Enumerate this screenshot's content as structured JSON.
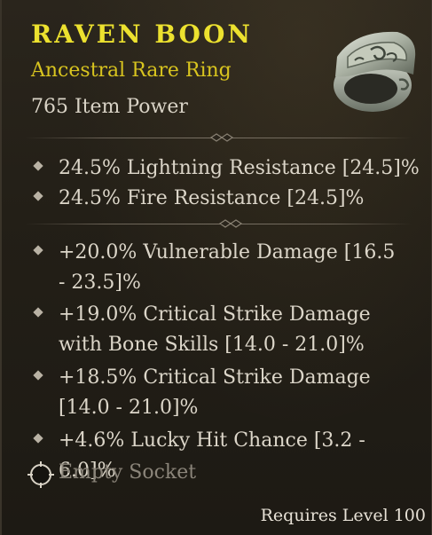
{
  "item": {
    "name": "RAVEN BOON",
    "rarity_type": "Ancestral Rare Ring",
    "item_power": "765 Item Power",
    "image": "ring-icon"
  },
  "implicits": [
    "24.5% Lightning Resistance [24.5]%",
    "24.5% Fire Resistance [24.5]%"
  ],
  "affixes": [
    "+20.0% Vulnerable Damage [16.5 - 23.5]%",
    "+19.0% Critical Strike Damage with Bone Skills [14.0 - 21.0]%",
    "+18.5% Critical Strike Damage [14.0 - 21.0]%",
    "+4.6% Lucky Hit Chance [3.2 - 6.0]%"
  ],
  "socket": {
    "label": "Empty Socket",
    "icon": "socket-icon"
  },
  "requirement": "Requires Level 100",
  "colors": {
    "name": "#ece12f",
    "rarity": "#d8c41f",
    "text": "#dcd6c9",
    "socket": "#8b857a",
    "background": "#231f17"
  }
}
